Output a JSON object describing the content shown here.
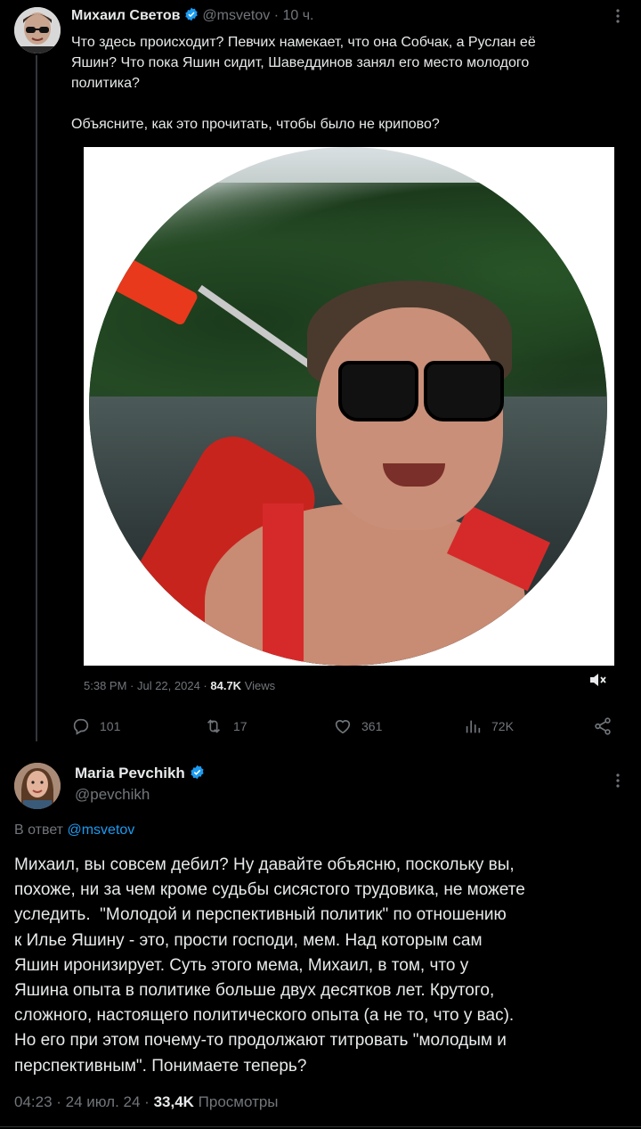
{
  "post1": {
    "author_name": "Михаил Светов",
    "handle": "@msvetov",
    "time": "· 10 ч.",
    "text_lines": [
      "Что здесь происходит? Певчих намекает, что она Собчак, а Руслан её",
      "Яшин? Что пока Яшин сидит, Шaвeддинов занял его место молодого",
      "политика?",
      "",
      "Объясните, как это прочитать, чтобы было не крипово?"
    ],
    "embedded_meta": {
      "time": "5:38 PM · Jul 22, 2024 ·",
      "views_count": "84.7K",
      "views_label": "Views"
    },
    "actions": {
      "replies": "101",
      "reposts": "17",
      "likes": "361",
      "views": "72K"
    }
  },
  "post2": {
    "author_name": "Maria Pevchikh",
    "handle": "@pevchikh",
    "reply_prefix": "В ответ",
    "reply_handle": "@msvetov",
    "text": "Михаил, вы совсем дебил? Ну давайте объясню, поскольку вы,\nпохоже, ни за чем кроме судьбы сисястого трудовика, не можете\nуследить.  \"Молодой и перспективный политик\" по отношению\nк Илье Яшину - это, прости господи, мем. Над которым сам\nЯшин иронизирует. Суть этого мема, Михаил, в том, что у\nЯшина опыта в политике больше двух десятков лет. Крутого,\nсложного, настоящего политического опыта (а не то, что у вас).\nНо его при этом почему-то продолжают титровать \"молодым и\nперспективным\". Понимаете теперь?",
    "meta_time": "04:23 · 24 июл. 24 ·",
    "views_count": "33,4K",
    "views_label": "Просмотры"
  },
  "colors": {
    "background": "#000000",
    "text": "#e7e9ea",
    "muted": "#71767b",
    "accent": "#1d9bf0",
    "verified": "#1d9bf0"
  },
  "icons": [
    "verified-badge-icon",
    "more-icon",
    "mute-icon",
    "reply-icon",
    "repost-icon",
    "like-icon",
    "views-icon",
    "share-icon"
  ]
}
